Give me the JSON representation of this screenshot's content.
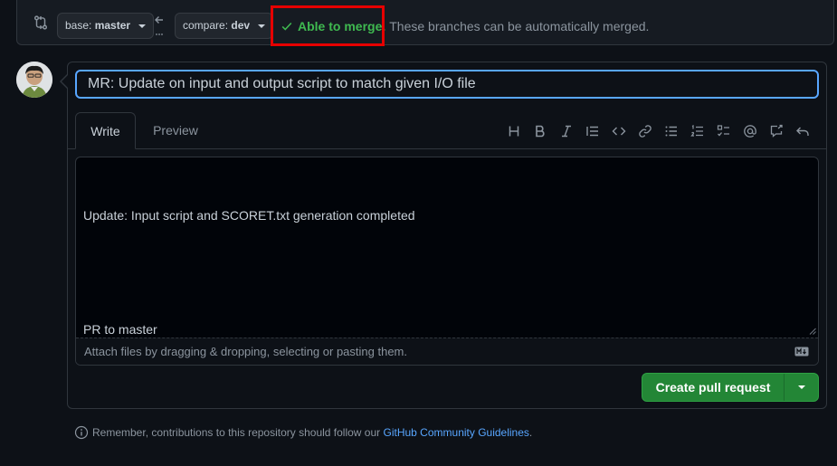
{
  "compare": {
    "base_label": "base:",
    "base_branch": "master",
    "compare_label": "compare:",
    "compare_branch": "dev",
    "merge_status": "Able to merge.",
    "merge_description": "These branches can be automatically merged."
  },
  "pr": {
    "title": "MR: Update on input and output script to match given I/O file",
    "tabs": [
      {
        "label": "Write",
        "active": true
      },
      {
        "label": "Preview",
        "active": false
      }
    ],
    "toolbar_icons": [
      "heading-icon",
      "bold-icon",
      "italic-icon",
      "quote-icon",
      "code-icon",
      "link-icon",
      "unordered-list-icon",
      "ordered-list-icon",
      "task-list-icon",
      "mention-icon",
      "reference-icon",
      "undo-icon"
    ],
    "body_lines": [
      "Update: Input script and SCORET.txt generation completed",
      "",
      "PR to master"
    ],
    "attach_hint": "Attach files by dragging & dropping, selecting or pasting them."
  },
  "actions": {
    "create_label": "Create pull request"
  },
  "footer": {
    "note_prefix": "Remember, contributions to this repository should follow our ",
    "link_text": "GitHub Community Guidelines",
    "note_suffix": "."
  },
  "colors": {
    "background": "#0d1117",
    "accent_green": "#238636",
    "merge_green": "#3fb950",
    "link_blue": "#58a6ff",
    "highlight_red": "#e60000"
  }
}
